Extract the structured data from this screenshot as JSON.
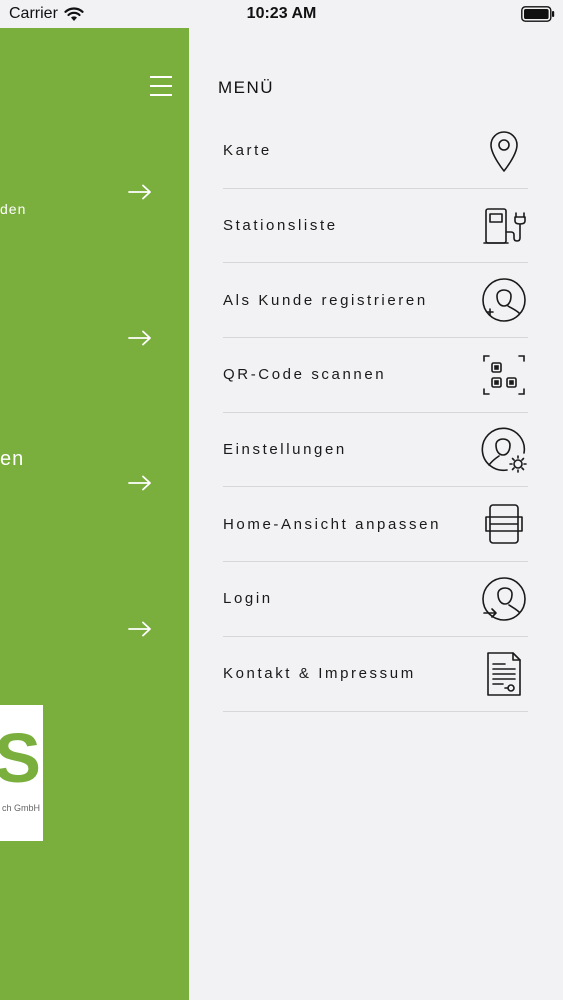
{
  "status_bar": {
    "carrier": "Carrier",
    "time": "10:23 AM"
  },
  "background_panel": {
    "peek_texts": [
      "den",
      "en"
    ],
    "logo_letter": "S",
    "logo_subtext": "ch GmbH"
  },
  "menu": {
    "title": "MENÜ",
    "items": [
      {
        "label": "Karte",
        "icon": "map-pin-icon"
      },
      {
        "label": "Stationsliste",
        "icon": "charging-station-icon"
      },
      {
        "label": "Als Kunde registrieren",
        "icon": "user-add-icon"
      },
      {
        "label": "QR-Code scannen",
        "icon": "qr-scan-icon"
      },
      {
        "label": "Einstellungen",
        "icon": "user-settings-icon"
      },
      {
        "label": "Home-Ansicht anpassen",
        "icon": "customize-home-icon"
      },
      {
        "label": "Login",
        "icon": "login-icon"
      },
      {
        "label": "Kontakt & Impressum",
        "icon": "document-icon"
      }
    ]
  },
  "colors": {
    "brand_green": "#7aaf3d",
    "menu_background": "#f2f2f4"
  }
}
